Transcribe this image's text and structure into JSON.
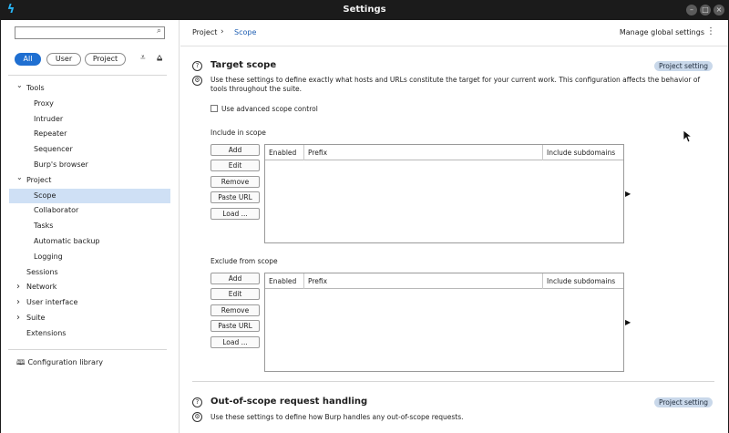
{
  "window": {
    "title": "Settings"
  },
  "sidebar": {
    "search_placeholder": "",
    "filters": {
      "all": "All",
      "user": "User",
      "project": "Project"
    },
    "tree": [
      {
        "label": "Tools",
        "level": 0,
        "expanded": true
      },
      {
        "label": "Proxy",
        "level": 1
      },
      {
        "label": "Intruder",
        "level": 1
      },
      {
        "label": "Repeater",
        "level": 1
      },
      {
        "label": "Sequencer",
        "level": 1
      },
      {
        "label": "Burp's browser",
        "level": 1
      },
      {
        "label": "Project",
        "level": 0,
        "expanded": true
      },
      {
        "label": "Scope",
        "level": 1,
        "selected": true
      },
      {
        "label": "Collaborator",
        "level": 1
      },
      {
        "label": "Tasks",
        "level": 1
      },
      {
        "label": "Automatic backup",
        "level": 1
      },
      {
        "label": "Logging",
        "level": 1
      },
      {
        "label": "Sessions",
        "level": 0
      },
      {
        "label": "Network",
        "level": 0,
        "expanded": false
      },
      {
        "label": "User interface",
        "level": 0,
        "expanded": false
      },
      {
        "label": "Suite",
        "level": 0,
        "expanded": false
      },
      {
        "label": "Extensions",
        "level": 0
      }
    ],
    "config_library": "Configuration library"
  },
  "header": {
    "breadcrumb": [
      "Project",
      "Scope"
    ],
    "manage_global": "Manage global settings"
  },
  "target_scope": {
    "title": "Target scope",
    "badge": "Project setting",
    "description": "Use these settings to define exactly what hosts and URLs constitute the target for your current work. This configuration affects the behavior of tools throughout the suite.",
    "advanced_label": "Use advanced scope control",
    "advanced_checked": false,
    "include": {
      "label": "Include in scope",
      "buttons": [
        "Add",
        "Edit",
        "Remove",
        "Paste URL",
        "Load ..."
      ],
      "columns": [
        "Enabled",
        "Prefix",
        "Include subdomains"
      ],
      "rows": []
    },
    "exclude": {
      "label": "Exclude from scope",
      "buttons": [
        "Add",
        "Edit",
        "Remove",
        "Paste URL",
        "Load ..."
      ],
      "columns": [
        "Enabled",
        "Prefix",
        "Include subdomains"
      ],
      "rows": []
    }
  },
  "out_of_scope": {
    "title": "Out-of-scope request handling",
    "badge": "Project setting",
    "description": "Use these settings to define how Burp handles any out-of-scope requests."
  },
  "colors": {
    "accent": "#1f6fd1",
    "selected_row": "#cfe0f5",
    "badge_bg": "#c9d8ea",
    "titlebar": "#1b1b1b"
  }
}
